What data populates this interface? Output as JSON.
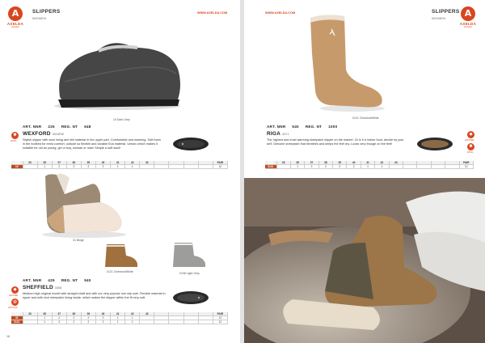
{
  "left": {
    "header": {
      "title": "SLIPPERS",
      "subtitle": "WOMEN",
      "url": "WWW.AXELDA.COM"
    },
    "logo": {
      "mark": "A",
      "word": "AXELDA",
      "tagline": "sweden"
    },
    "product1": {
      "caption": "10 Dark Grey",
      "art_no_label": "ART. NNR",
      "art_no": "225",
      "bulk_label": "REG. NT",
      "bulk": "648",
      "name": "WEXFORD",
      "code": "3016FW",
      "description": "Stylish slipper with wool lining and felt material in the upper part. Comfortable and warming. Soft foam in the footbed for extra comfort, outsole so flexible and durable Eva material. Unisex which makes it suitable for old an young, girl or boy, woman or man! Simple a soft wool!",
      "badge_label": "WOOL",
      "sizes": {
        "header_label": "SIZE",
        "header": [
          "33",
          "35",
          "37",
          "38",
          "39",
          "40",
          "41",
          "42",
          "43",
          "",
          "",
          "",
          "",
          "PAIR"
        ],
        "rows": [
          {
            "label": "10",
            "values": [
              "",
              "1",
              "2",
              "2",
              "2",
              "2",
              "1",
              "1",
              "",
              "",
              "",
              "",
              "",
              "12"
            ]
          }
        ]
      }
    },
    "product2": {
      "caption_main": "31 Beige",
      "caption_a": "0121 Chestnut/White",
      "caption_b": "0108 Light Grey",
      "art_no_label": "ART. NNR",
      "art_no": "425",
      "bulk_label": "REG. NT",
      "bulk": "940",
      "name": "SHEFFIELD",
      "code": "3306",
      "description": "Medium high original model with straight shaft and with our very popular non slip sole. Flexible material in upper and with nice sheepskin lining inside, which makes the slipper within the fit very soft.",
      "badges": [
        "LEATHER",
        "NON SLIP"
      ],
      "sizes": {
        "header_label": "SIZE",
        "header": [
          "33",
          "35",
          "37",
          "38",
          "39",
          "40",
          "41",
          "42",
          "43",
          "",
          "",
          "",
          "",
          "PAIR"
        ],
        "rows": [
          {
            "label": "31",
            "values": [
              "",
              "1",
              "2",
              "2",
              "2",
              "2",
              "1",
              "1",
              "",
              "",
              "",
              "",
              "",
              "12"
            ]
          },
          {
            "label": "0121",
            "values": [
              "",
              "1",
              "2",
              "2",
              "2",
              "2",
              "1",
              "1",
              "",
              "",
              "",
              "",
              "",
              "12"
            ]
          }
        ]
      }
    },
    "page_number": "16"
  },
  "right": {
    "header": {
      "title": "SLIPPERS",
      "subtitle": "WOMEN",
      "url": "WWW.AXELDA.COM"
    },
    "logo": {
      "mark": "A",
      "word": "AXELDA",
      "tagline": "sweden"
    },
    "product": {
      "caption": "0121 Chestnut/White",
      "art_no_label": "ART. NNR",
      "art_no": "540",
      "bulk_label": "REG. NT",
      "bulk": "1000",
      "name": "RIGA",
      "code": "3471",
      "description": "The highest and most warming sheepskin slipper on the market. Or is it a indoor boot, decide by your self. Genuine sheepskin that breathes and keeps the feet dry. Looks very though on the feet!",
      "badges": [
        "LEATHER",
        "WOOL"
      ],
      "sizes": {
        "header_label": "SIZE",
        "header": [
          "33",
          "35",
          "37",
          "38",
          "39",
          "40",
          "41",
          "42",
          "43",
          "",
          "",
          "",
          "",
          "PAIR"
        ],
        "rows": [
          {
            "label": "0121",
            "values": [
              "",
              "1",
              "2",
              "2",
              "2",
              "2",
              "1",
              "1",
              "",
              "",
              "",
              "",
              "",
              "12"
            ]
          }
        ]
      }
    }
  },
  "colors": {
    "accent": "#d9461e",
    "table_label": "#c24a1e"
  }
}
